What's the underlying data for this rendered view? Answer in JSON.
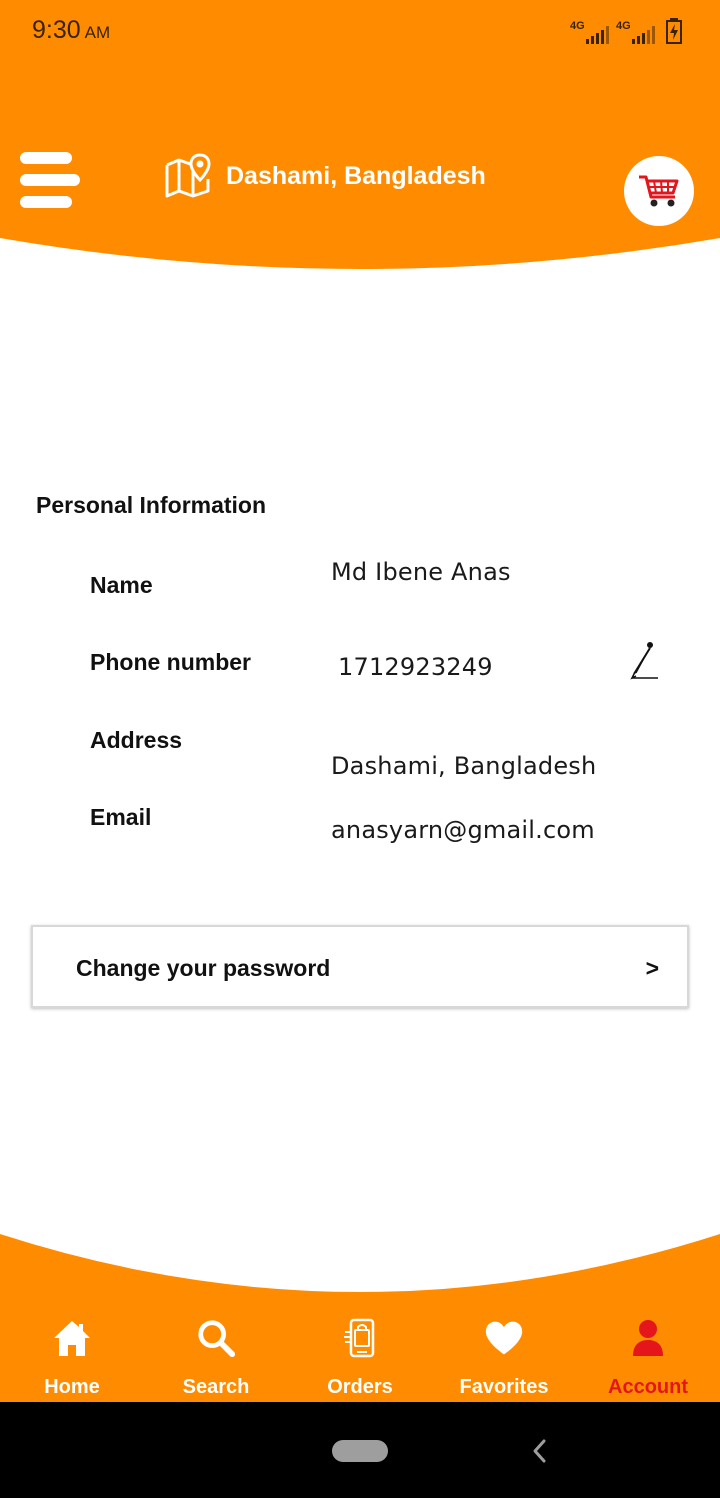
{
  "status_bar": {
    "time": "9:30",
    "ampm": "AM",
    "network_1": "4G",
    "network_2": "4G"
  },
  "header": {
    "location": "Dashami, Bangladesh",
    "menu_icon": "hamburger-menu-icon",
    "location_icon": "map-pin-icon",
    "cart_icon": "shopping-cart-icon"
  },
  "profile": {
    "section_title": "Personal Information",
    "fields": [
      {
        "label": "Name",
        "value": "Md Ibene Anas"
      },
      {
        "label": "Phone number",
        "value": "1712923249"
      },
      {
        "label": "Address",
        "value": "Dashami, Bangladesh"
      },
      {
        "label": "Email",
        "value": "anasyarn@gmail.com"
      }
    ],
    "edit_icon": "pencil-edit-icon"
  },
  "change_password": {
    "label": "Change your password",
    "arrow": ">"
  },
  "bottom_nav": {
    "items": [
      {
        "label": "Home",
        "icon": "home-icon"
      },
      {
        "label": "Search",
        "icon": "search-icon"
      },
      {
        "label": "Orders",
        "icon": "orders-icon"
      },
      {
        "label": "Favorites",
        "icon": "heart-icon"
      },
      {
        "label": "Account",
        "icon": "user-icon"
      }
    ],
    "active": "Account"
  },
  "colors": {
    "brand_orange": "#ff8c00",
    "active_red": "#e5151c",
    "white": "#ffffff"
  }
}
